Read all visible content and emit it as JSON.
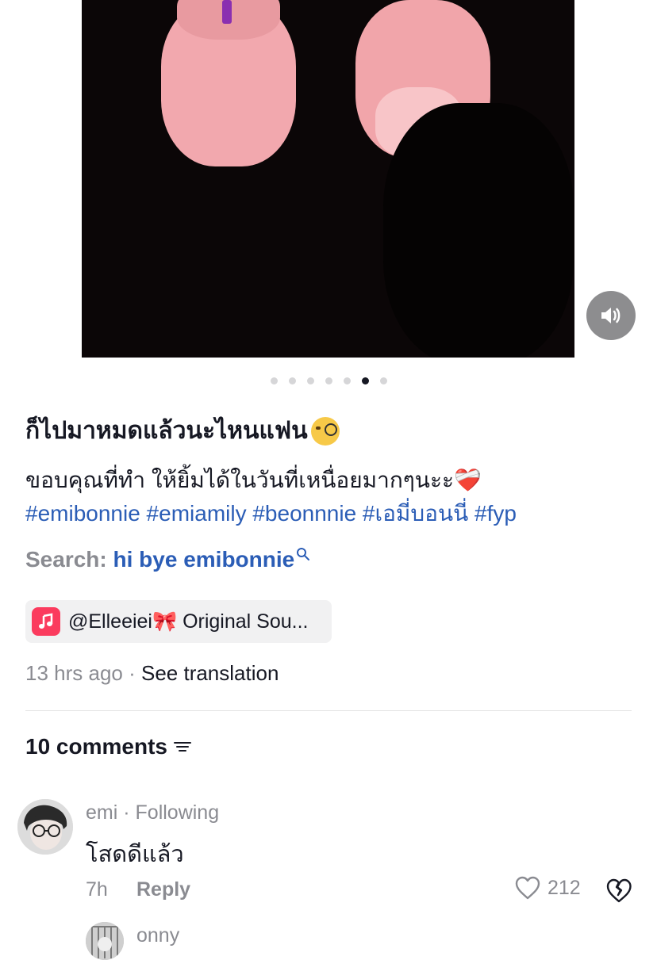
{
  "media": {
    "total_slides": 7,
    "active_slide": 6
  },
  "caption": {
    "title": "ก็ไปมาหมดแล้วนะไหนแฟน",
    "title_emoji": "monocle-face",
    "body": "ขอบคุณที่ทำ ให้ยิ้มได้ในวันที่เหนื่อยมากๆนะะ",
    "body_emoji": "❤️‍🩹",
    "hashtags": "#emibonnie #emiamily #beonnnie #เอมี่บอนนี่ #fyp"
  },
  "search": {
    "prefix": "Search:",
    "term": "hi bye emibonnie"
  },
  "sound": {
    "handle": "@Elleeiei",
    "bow": "🎀",
    "title": " Original Sou..."
  },
  "meta": {
    "time_ago": "13 hrs ago",
    "separator": " · ",
    "translate": "See translation"
  },
  "comments": {
    "count_label": "10 comments",
    "items": [
      {
        "author": "emi",
        "relation": " · Following",
        "text": "โสดดีแล้ว",
        "time": "7h",
        "reply_label": "Reply",
        "likes": "212"
      }
    ],
    "next_author": "onny"
  },
  "colors": {
    "link": "#2b5db6",
    "muted": "#8a8b91",
    "music_accent": "#fb3b5e"
  }
}
